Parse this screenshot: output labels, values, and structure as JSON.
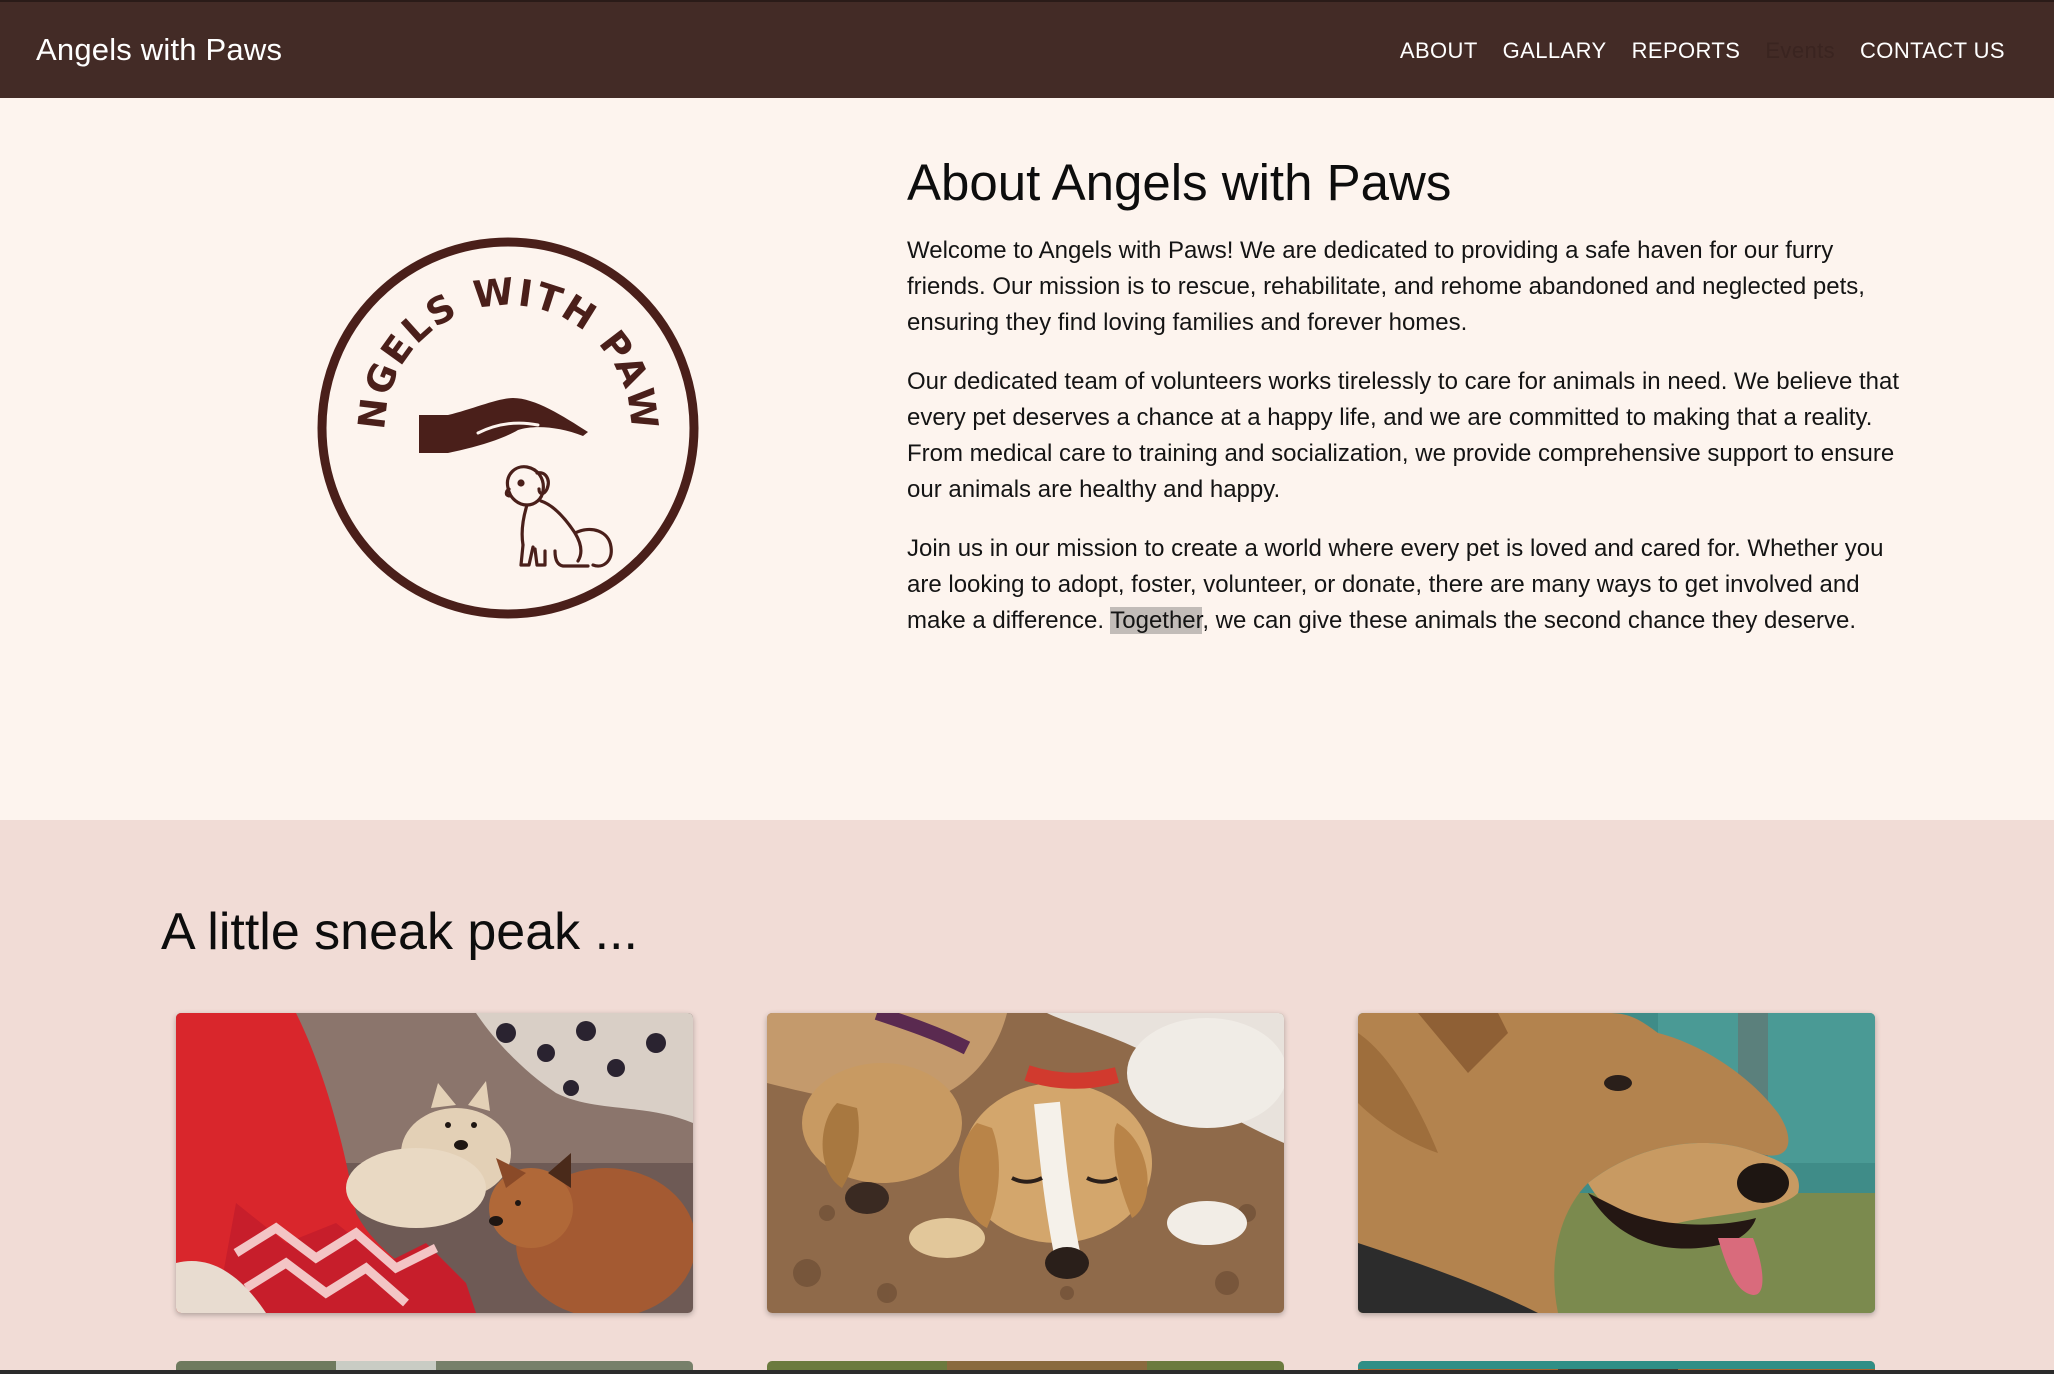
{
  "header": {
    "brand": "Angels with Paws",
    "nav": [
      "ABOUT",
      "GALLARY",
      "REPORTS",
      "Events",
      "CONTACT US"
    ]
  },
  "about": {
    "logo_text": "ANGELS WITH PAWS",
    "title": "About Angels with Paws",
    "paragraph_1": "Welcome to Angels with Paws! We are dedicated to providing a safe haven for our furry friends. Our mission is to rescue, rehabilitate, and rehome abandoned and neglected pets, ensuring they find loving families and forever homes.",
    "paragraph_2": "Our dedicated team of volunteers works tirelessly to care for animals in need. We believe that every pet deserves a chance at a happy life, and we are committed to making that a reality. From medical care to training and socialization, we provide comprehensive support to ensure our animals are healthy and happy.",
    "paragraph_3_before": "Join us in our mission to create a world where every pet is loved and cared for. Whether you are looking to adopt, foster, volunteer, or donate, there are many ways to get involved and make a difference. ",
    "paragraph_3_highlight": "Together",
    "paragraph_3_after": ", we can give these animals the second chance they deserve."
  },
  "gallery": {
    "title": "A little sneak peak ..."
  },
  "colors": {
    "header_bg": "#432b26",
    "about_bg": "#fdf4ee",
    "gallery_bg": "#f1dcd6",
    "logo": "#4a1f1a"
  }
}
